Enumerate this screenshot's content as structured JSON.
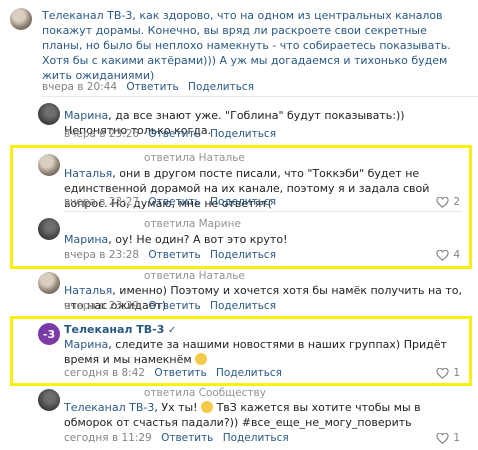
{
  "comments": [
    {
      "author": "",
      "text": "Телеканал ТВ-3, как здорово, что на одном из центральных каналов покажут дорамы. Конечно, вы вряд ли раскроете свои секретные планы, но было бы неплохо намекнуть - что собираетесь показывать. Хотя бы с какими актёрами))) А уж мы догадаемся и тихонько будем жить ожиданиями)",
      "time": "вчера в 20:44",
      "reply": "Ответить",
      "share": "Поделиться"
    },
    {
      "author": "Марина",
      "text": ", да все знают уже. \"Гоблина\" будут показывать:)) Непонятно только когда.",
      "time": "вчера в 23:26",
      "reply": "Ответить",
      "share": "Поделиться"
    },
    {
      "replied_to": "ответила Наталье",
      "author": "Наталья",
      "text": ", они в другом посте писали, что \"Токкэби\" будет не единственной дорамой на их канале, поэтому я и задала свой вопрос. Но, думаю, мне не ответят(",
      "time": "вчера в 23:27",
      "reply": "Ответить",
      "share": "Поделиться",
      "likes": "2"
    },
    {
      "replied_to": "ответила Марине",
      "author": "Марина",
      "text": ", оу! Не один? А вот это круто!",
      "time": "вчера в 23:28",
      "reply": "Ответить",
      "share": "Поделиться",
      "likes": "4"
    },
    {
      "replied_to": "ответила Наталье",
      "author": "Наталья",
      "text": ", именно) Поэтому и хочется хотя бы намёк получить на то, что нас ожидает)",
      "time": "вчера в 23:29",
      "reply": "Ответить",
      "share": "Поделиться"
    },
    {
      "author": "Телеканал ТВ-3",
      "mention": "Марина",
      "text": ", следите за нашими новостями в наших группах) Придёт время и мы намекнём",
      "time": "сегодня в 8:42",
      "reply": "Ответить",
      "share": "Поделиться",
      "likes": "1"
    },
    {
      "replied_to": "ответила Сообществу",
      "author": "Телеканал ТВ-3",
      "text": ", Ух ты! ",
      "text2": " ТвЗ кажется вы хотите чтобы мы в обморок от счастья падали?)) #все_еще_не_могу_поверить",
      "time": "сегодня в 11:29",
      "reply": "Ответить",
      "share": "Поделиться",
      "likes": "1"
    }
  ],
  "colors": {
    "highlight": "#f7f10d",
    "link": "#2a5885",
    "muted": "#828282"
  },
  "icons": [
    "heart-icon",
    "verified-icon",
    "smile-emoji-icon"
  ]
}
